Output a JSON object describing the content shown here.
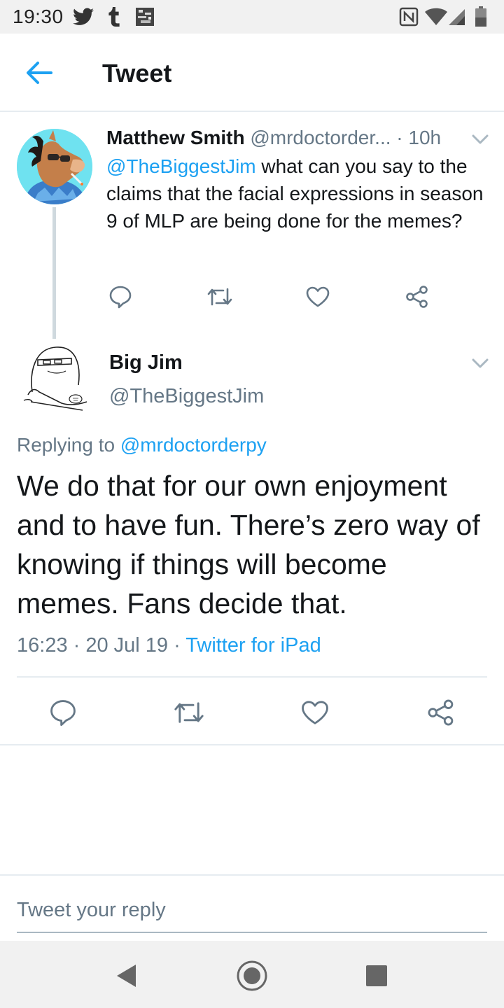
{
  "status_bar": {
    "time": "19:30",
    "icons": [
      "twitter-icon",
      "tumblr-icon",
      "image-notification-icon",
      "nfc-icon",
      "wifi-icon",
      "signal-icon",
      "battery-icon"
    ]
  },
  "app_bar": {
    "title": "Tweet",
    "back_icon": "arrow-left-icon"
  },
  "parent_tweet": {
    "name": "Matthew Smith",
    "handle": "@mrdoctorder...",
    "time": "· 10h",
    "mention": "@TheBiggestJim",
    "text": " what can you say to the claims that the facial expressions in season 9 of MLP are being done for the memes?"
  },
  "focus_tweet": {
    "name": "Big Jim",
    "handle": "@TheBiggestJim",
    "replying_prefix": "Replying to ",
    "replying_handle": "@mrdoctorderpy",
    "text": "We do that for our own enjoyment and to have fun. There’s zero way of knowing if things will become memes. Fans decide that.",
    "timestamp": "16:23 · 20 Jul 19 · ",
    "client": "Twitter for iPad"
  },
  "reply_bar": {
    "placeholder": "Tweet your reply"
  },
  "colors": {
    "accent": "#1da1f2",
    "muted": "#657786",
    "text": "#14171a",
    "divider": "#e6ecf0"
  }
}
